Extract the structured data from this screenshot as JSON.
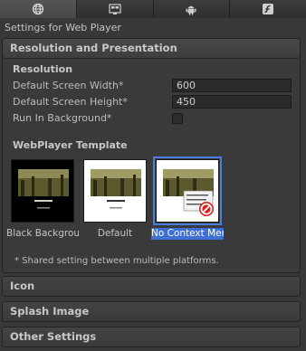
{
  "tabs": [
    {
      "icon": "globe-icon"
    },
    {
      "icon": "windows-icon"
    },
    {
      "icon": "android-icon"
    },
    {
      "icon": "flash-icon"
    }
  ],
  "settings_title": "Settings for Web Player",
  "resolution_panel": {
    "header": "Resolution and Presentation",
    "resolution_label": "Resolution",
    "width_label": "Default Screen Width*",
    "width_value": "600",
    "height_label": "Default Screen Height*",
    "height_value": "450",
    "run_in_background_label": "Run In Background*",
    "run_in_background_checked": false
  },
  "webplayer_template": {
    "label": "WebPlayer Template",
    "templates": [
      {
        "caption": "Black Backgroun",
        "selected": false
      },
      {
        "caption": "Default",
        "selected": false
      },
      {
        "caption": "No Context Men",
        "selected": true
      }
    ]
  },
  "shared_note": "* Shared setting between multiple platforms.",
  "foldouts": [
    "Icon",
    "Splash Image",
    "Other Settings"
  ],
  "colors": {
    "selection_blue": "#3e6fd4",
    "panel_bg": "#3a3a3a"
  }
}
